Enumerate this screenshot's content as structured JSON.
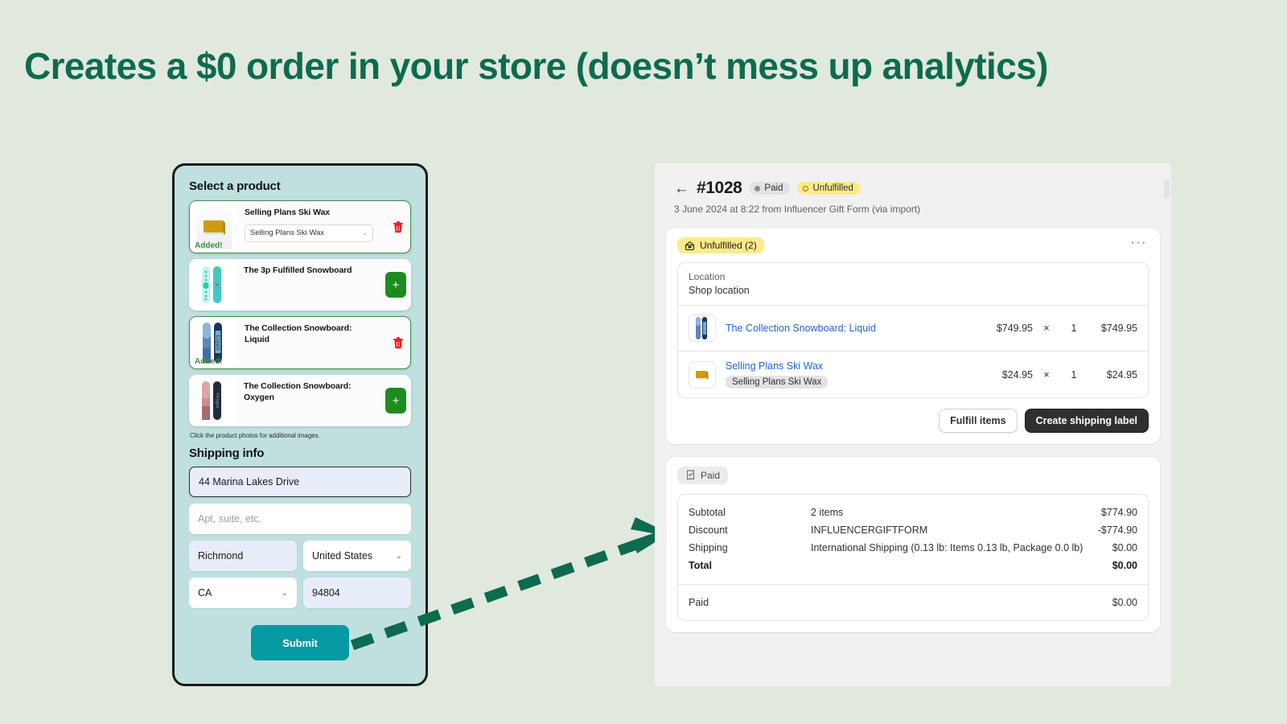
{
  "headline": "Creates a $0 order in your store (doesn’t mess up analytics)",
  "theme": {
    "page_bg": "#e1e9dd",
    "headline_color": "#0d6b4f",
    "arrow_color": "#0d6b4f",
    "panel_bg": "#c0e0e0",
    "submit_bg": "#069aa2",
    "added_green": "#3f9144",
    "add_button_green": "#1e8b1e",
    "trash_red": "#ee2222",
    "link_blue": "#1f62d6",
    "badge_yellow": "#ffea8a"
  },
  "form_panel": {
    "title": "Select a product",
    "products": [
      {
        "name": "Selling Plans Ski Wax",
        "state": "added",
        "added_label": "Added!",
        "variant_value": "Selling Plans Ski Wax",
        "action_icon": "trash-icon",
        "thumb": "ski-wax"
      },
      {
        "name": "The 3p Fulfilled Snowboard",
        "state": "available",
        "action_icon": "plus-icon",
        "action_label": "+",
        "thumb": "snowboard-teal"
      },
      {
        "name": "The Collection Snowboard: Liquid",
        "state": "added",
        "added_label": "Added!",
        "action_icon": "trash-icon",
        "thumb": "snowboard-liquid"
      },
      {
        "name": "The Collection Snowboard: Oxygen",
        "state": "available",
        "action_icon": "plus-icon",
        "action_label": "+",
        "thumb": "snowboard-oxygen"
      }
    ],
    "helper_text": "Click the product photos for additional images.",
    "shipping_title": "Shipping info",
    "fields": {
      "address1_value": "44 Marina Lakes Drive",
      "address2_placeholder": "Apt, suite, etc.",
      "city_value": "Richmond",
      "country_value": "United States",
      "province_value": "CA",
      "zip_value": "94804"
    },
    "submit_label": "Submit"
  },
  "admin": {
    "back_icon": "back-arrow-icon",
    "order_number": "#1028",
    "status_payment": "Paid",
    "status_fulfillment": "Unfulfilled",
    "order_meta": "3 June 2024 at 8:22 from Influencer Gift Form (via import)",
    "fulfillment_card": {
      "badge": "Unfulfilled (2)",
      "badge_icon": "package-icon",
      "kebab": "···",
      "location_label": "Location",
      "location_value": "Shop location",
      "items": [
        {
          "title": "The Collection Snowboard: Liquid",
          "variant": "",
          "price": "$749.95",
          "times": "×",
          "qty": "1",
          "total": "$749.95",
          "thumb": "snowboard-liquid"
        },
        {
          "title": "Selling Plans Ski Wax",
          "variant": "Selling Plans Ski Wax",
          "price": "$24.95",
          "times": "×",
          "qty": "1",
          "total": "$24.95",
          "thumb": "ski-wax"
        }
      ],
      "fulfill_button": "Fulfill items",
      "shipping_label_button": "Create shipping label"
    },
    "payment_card": {
      "badge": "Paid",
      "badge_icon": "receipt-check-icon",
      "rows": [
        {
          "key": "Subtotal",
          "mid": "2 items",
          "value": "$774.90"
        },
        {
          "key": "Discount",
          "mid": "INFLUENCERGIFTFORM",
          "value": "-$774.90"
        },
        {
          "key": "Shipping",
          "mid": "International Shipping (0.13 lb: Items 0.13 lb, Package 0.0 lb)",
          "value": "$0.00"
        },
        {
          "key": "Total",
          "mid": "",
          "value": "$0.00"
        }
      ],
      "paid_key": "Paid",
      "paid_value": "$0.00"
    }
  }
}
